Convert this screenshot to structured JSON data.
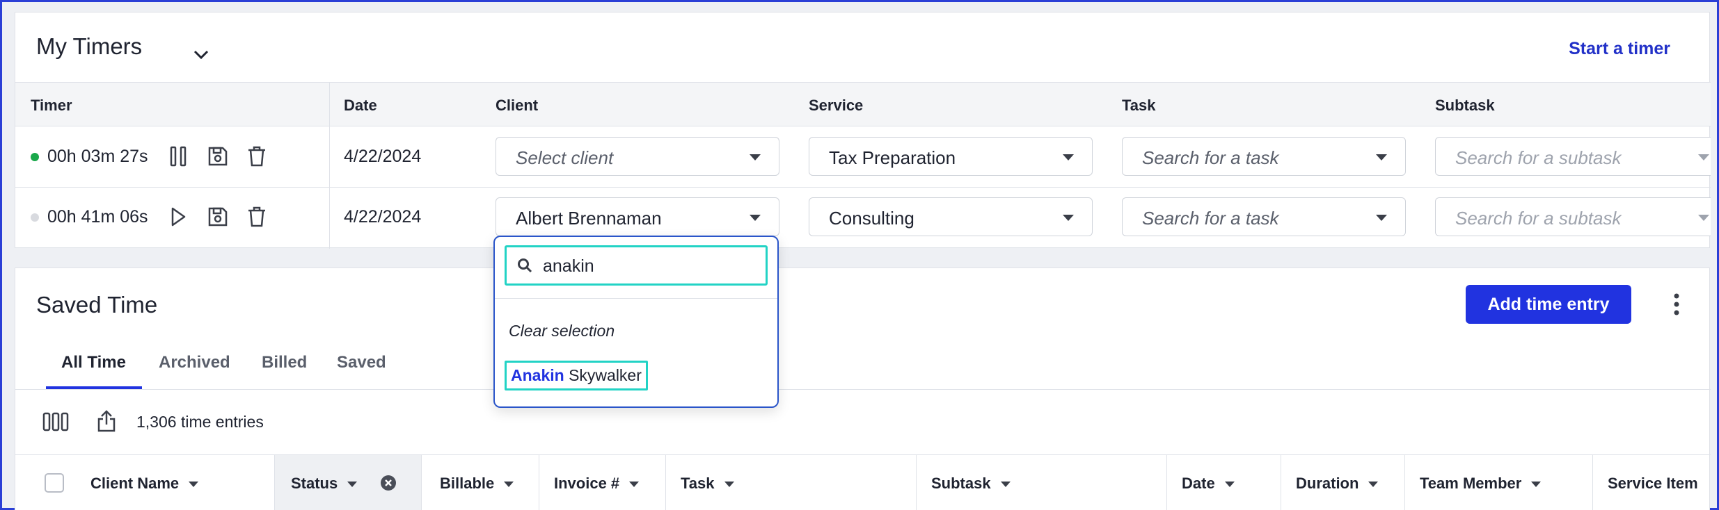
{
  "timers": {
    "title": "My Timers",
    "start_link": "Start a timer",
    "columns": [
      "Timer",
      "Date",
      "Client",
      "Service",
      "Task",
      "Subtask"
    ],
    "rows": [
      {
        "time": "00h 03m 27s",
        "running": true,
        "date": "4/22/2024",
        "client": "Select client",
        "service": "Tax Preparation",
        "task": "Search for a task",
        "subtask": "Search for a subtask"
      },
      {
        "time": "00h 41m 06s",
        "running": false,
        "date": "4/22/2024",
        "client": "Albert Brennaman",
        "service": "Consulting",
        "task": "Search for a task",
        "subtask": "Search for a subtask"
      }
    ]
  },
  "client_dropdown": {
    "search_value": "anakin",
    "clear_label": "Clear selection",
    "option_match": "Anakin",
    "option_rest": "Skywalker"
  },
  "saved": {
    "title": "Saved Time",
    "add_button": "Add time entry",
    "tabs": [
      "All Time",
      "Archived",
      "Billed",
      "Saved"
    ],
    "active_tab": "All Time",
    "entries_count": "1,306 time entries",
    "columns": [
      "Client Name",
      "Status",
      "Billable",
      "Invoice #",
      "Task",
      "Subtask",
      "Date",
      "Duration",
      "Team Member",
      "Service Item"
    ]
  },
  "colors": {
    "accent": "#2133e0",
    "running_dot": "#1aa84b",
    "paused_dot": "#d8dadf",
    "highlight_outline": "#22d3c5"
  }
}
